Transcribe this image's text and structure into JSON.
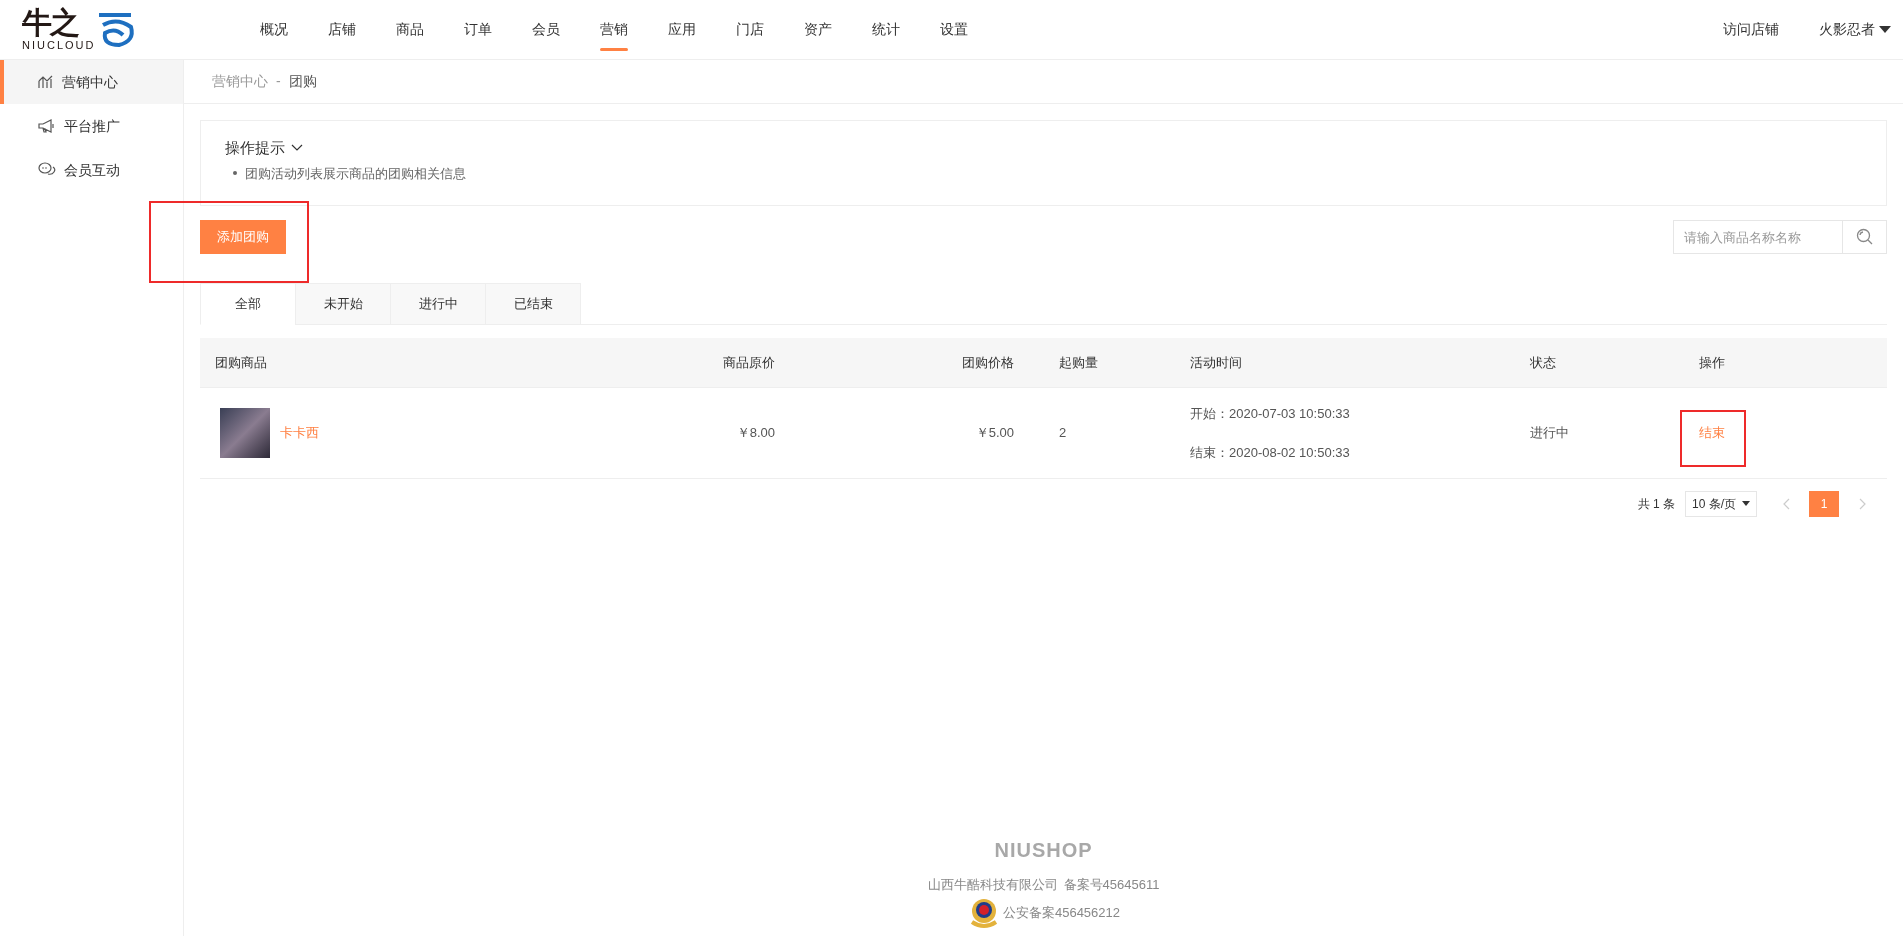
{
  "logo": {
    "brand": "牛之",
    "sub": "NIUCLOUD"
  },
  "nav": [
    {
      "label": "概况",
      "selected": false
    },
    {
      "label": "店铺",
      "selected": false
    },
    {
      "label": "商品",
      "selected": false
    },
    {
      "label": "订单",
      "selected": false
    },
    {
      "label": "会员",
      "selected": false
    },
    {
      "label": "营销",
      "selected": true
    },
    {
      "label": "应用",
      "selected": false
    },
    {
      "label": "门店",
      "selected": false
    },
    {
      "label": "资产",
      "selected": false
    },
    {
      "label": "统计",
      "selected": false
    },
    {
      "label": "设置",
      "selected": false
    }
  ],
  "header_right": {
    "visit_store": "访问店铺",
    "user": "火影忍者"
  },
  "sidebar": {
    "items": [
      {
        "label": "营销中心",
        "kind": "chart",
        "selected": true
      },
      {
        "label": "平台推广",
        "kind": "megaphone",
        "selected": false
      },
      {
        "label": "会员互动",
        "kind": "chat",
        "selected": false
      }
    ]
  },
  "breadcrumb": [
    "营销中心",
    "团购"
  ],
  "breadcrumb_separator": "-",
  "tips": {
    "title": "操作提示",
    "items": [
      "团购活动列表展示商品的团购相关信息"
    ]
  },
  "add_button": "添加团购",
  "search": {
    "placeholder": "请输入商品名称名称"
  },
  "tabs": [
    {
      "label": "全部",
      "selected": true
    },
    {
      "label": "未开始",
      "selected": false
    },
    {
      "label": "进行中",
      "selected": false
    },
    {
      "label": "已结束",
      "selected": false
    }
  ],
  "table": {
    "columns": [
      "团购商品",
      "商品原价",
      "团购价格",
      "起购量",
      "活动时间",
      "状态",
      "操作"
    ],
    "rows": [
      {
        "product": "卡卡西",
        "original_price": "￥8.00",
        "group_price": "￥5.00",
        "min_qty": "2",
        "start": "开始：2020-07-03 10:50:33",
        "end": "结束：2020-08-02 10:50:33",
        "status": "进行中",
        "action": "结束"
      }
    ]
  },
  "pagination": {
    "total": "共 1 条",
    "page_size": "10 条/页",
    "pages": [
      {
        "label": "1",
        "selected": true
      }
    ]
  },
  "footer": {
    "brand": "NIUSHOP",
    "company": "山西牛酷科技有限公司",
    "icp": "备案号45645611",
    "police": "公安备案456456212"
  }
}
